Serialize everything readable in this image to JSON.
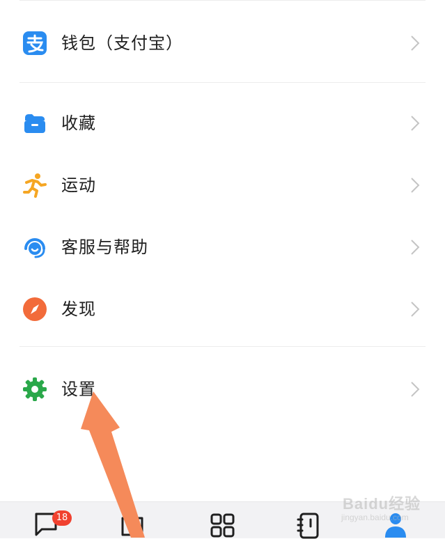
{
  "menu": {
    "items": [
      {
        "label": "钱包（支付宝）",
        "icon": "alipay-icon",
        "color": "#2a8cf0"
      },
      {
        "label": "收藏",
        "icon": "folder-icon",
        "color": "#2a8cf0"
      },
      {
        "label": "运动",
        "icon": "running-icon",
        "color": "#f5a623"
      },
      {
        "label": "客服与帮助",
        "icon": "headset-icon",
        "color": "#2a8cf0"
      },
      {
        "label": "发现",
        "icon": "compass-icon",
        "color": "#f26b3a"
      },
      {
        "label": "设置",
        "icon": "gear-icon",
        "color": "#2aa84a"
      }
    ]
  },
  "tabbar": {
    "messages_badge": "18",
    "active_color": "#2a8cf0"
  },
  "watermark": {
    "brand": "Baidu经验",
    "url": "jingyan.baidu.com"
  },
  "annotation": {
    "arrow_color": "#f58a5a"
  }
}
